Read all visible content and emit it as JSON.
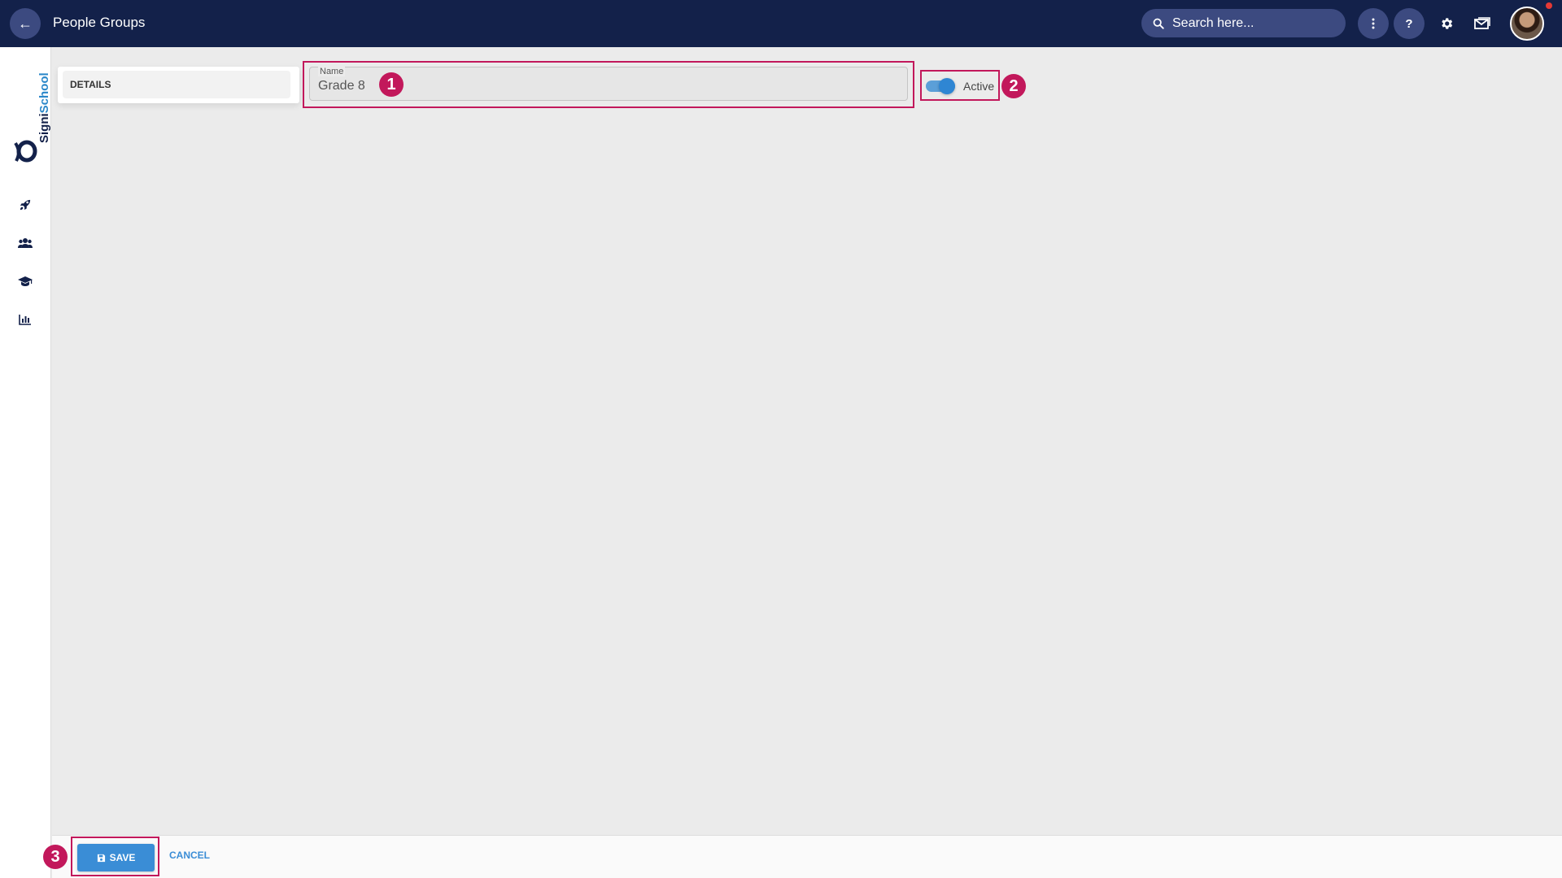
{
  "header": {
    "back_icon": "arrow-left-icon",
    "title": "People Groups",
    "search_placeholder": "Search here...",
    "more_icon": "more-vertical-icon",
    "help_label": "?",
    "settings_icon": "gear-icon",
    "messages_icon": "mail-icon",
    "avatar": "user-avatar"
  },
  "sidebar": {
    "logo_text_part1": "Signi",
    "logo_text_part2": "School",
    "items": [
      {
        "icon": "rocket-icon"
      },
      {
        "icon": "people-icon"
      },
      {
        "icon": "graduation-cap-icon"
      },
      {
        "icon": "bar-chart-icon"
      }
    ]
  },
  "details": {
    "tab_label": "DETAILS"
  },
  "form": {
    "name_label": "Name",
    "name_value": "Grade 8",
    "active_label": "Active",
    "active": true
  },
  "annotations": [
    "1",
    "2",
    "3"
  ],
  "footer": {
    "save_label": "SAVE",
    "cancel_label": "CANCEL"
  },
  "colors": {
    "topbar": "#13214a",
    "accent": "#3a8dd6",
    "annotation": "#c2185b",
    "background": "#ebebeb"
  }
}
